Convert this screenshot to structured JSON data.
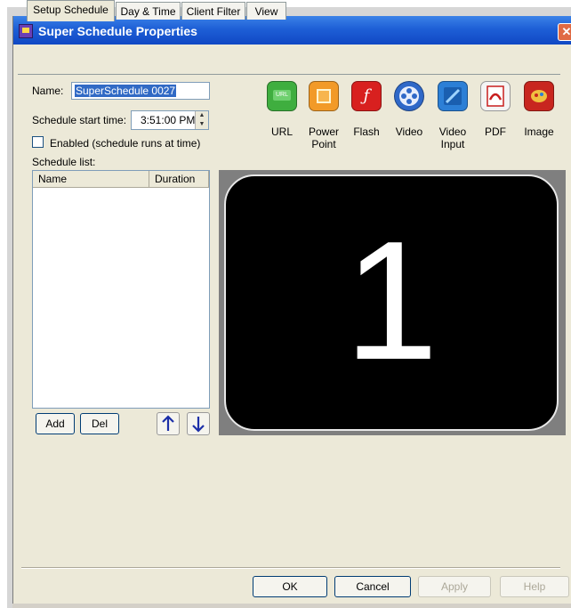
{
  "window": {
    "title": "Super Schedule Properties",
    "close_glyph": "✕"
  },
  "tabs": [
    {
      "label": "Setup Schedule"
    },
    {
      "label": "Day & Time"
    },
    {
      "label": "Client Filter"
    },
    {
      "label": "View"
    }
  ],
  "form": {
    "name_label": "Name:",
    "name_value": "SuperSchedule 0027",
    "start_time_label": "Schedule start time:",
    "start_time_value": "3:51:00 PM",
    "enabled_label": "Enabled (schedule runs at time)",
    "enabled_checked": false,
    "schedule_list_label": "Schedule list:"
  },
  "schedule_list": {
    "columns": [
      "Name",
      "Duration"
    ],
    "rows": []
  },
  "list_buttons": {
    "add": "Add",
    "del": "Del",
    "up_glyph": "↑",
    "down_glyph": "↓"
  },
  "media_types": [
    {
      "label": "URL",
      "icon": "url-icon",
      "color": "#3fae3f",
      "glyph": "URL"
    },
    {
      "label": "Power Point",
      "icon": "powerpoint-icon",
      "color": "#f29a28",
      "glyph": "▣"
    },
    {
      "label": "Flash",
      "icon": "flash-icon",
      "color": "#d8201f",
      "glyph": "ƒ"
    },
    {
      "label": "Video",
      "icon": "video-icon",
      "color": "#2f68c8",
      "glyph": "⊛"
    },
    {
      "label": "Video Input",
      "icon": "video-input-icon",
      "color": "#2c7fd6",
      "glyph": "⟋"
    },
    {
      "label": "PDF",
      "icon": "pdf-icon",
      "color": "#f4f4f4",
      "glyph": "✓"
    },
    {
      "label": "Image",
      "icon": "image-icon",
      "color": "#c8261f",
      "glyph": "✿"
    }
  ],
  "preview": {
    "number": "1"
  },
  "dialog_buttons": {
    "ok": "OK",
    "cancel": "Cancel",
    "apply": "Apply",
    "help": "Help"
  }
}
